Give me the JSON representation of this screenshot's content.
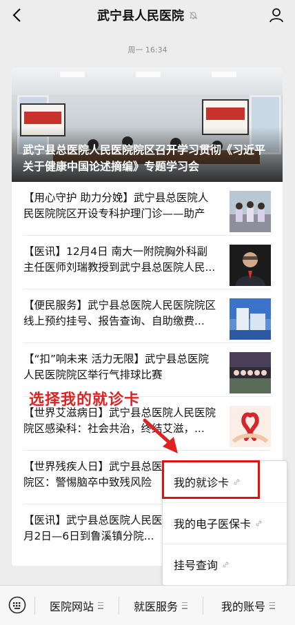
{
  "header": {
    "title": "武宁县人民医院",
    "back_icon": "chevron-left-icon",
    "mute_icon": "bell-off-icon",
    "profile_icon": "person-icon"
  },
  "timestamp": "周一 16:34",
  "article": {
    "hero_caption": "武宁县总医院人民医院院区召开学习贯彻《习近平关于健康中国论述摘编》专题学习会",
    "items": [
      {
        "text": "【用心守护 助力分娩】武宁县总医院人民医院院区开设专科护理门诊——助产士..."
      },
      {
        "text": "【医讯】12月4日 南大一附院胸外科副主任医师刘瑞教授到武宁县总医院人民..."
      },
      {
        "text": "【便民服务】武宁县总医院人民医院院区线上预约挂号、报告查询、自助缴费..."
      },
      {
        "text": "【“扣”响未来 活力无限】武宁县总医院人民医院院区举行气排球比赛"
      },
      {
        "text": "【世界艾滋病日】武宁县总医院人民医院院区感染科：社会共治，终结艾滋，..."
      },
      {
        "text": "【世界残疾人日】武宁县总医院人民医院院区：警惕脑卒中致残风险"
      },
      {
        "text": "【医讯】武宁县总医院人民医院院区12月2日—6日到鲁溪镇分院..."
      }
    ]
  },
  "annotation": {
    "text": "选择我的就诊卡",
    "color": "#e02121"
  },
  "popup_menu": {
    "items": [
      {
        "label": "我的就诊卡"
      },
      {
        "label": "我的电子医保卡"
      },
      {
        "label": "挂号查询"
      }
    ],
    "link_icon": "link-icon"
  },
  "bottom_menu": {
    "keyboard_icon": "keyboard-icon",
    "tabs": [
      {
        "label": "医院网站"
      },
      {
        "label": "就医服务"
      },
      {
        "label": "我的账号"
      }
    ],
    "menu_icon": "menu-lines-icon"
  },
  "highlight_color": "#e01010"
}
